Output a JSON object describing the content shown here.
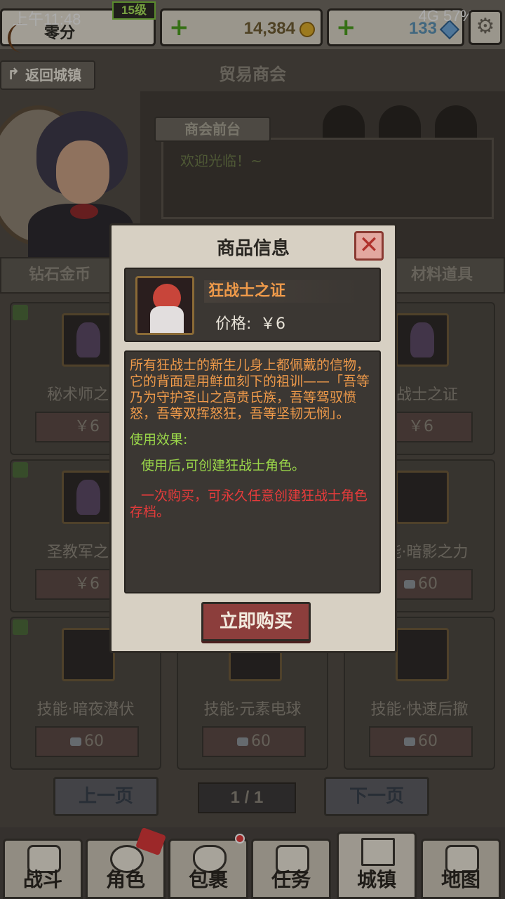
{
  "status_bar": {
    "time": "上午11:48",
    "right": "4G 57%"
  },
  "player": {
    "name": "零分",
    "level": "15级"
  },
  "resources": {
    "coins": "14,384",
    "gems": "133"
  },
  "header": {
    "back_label": "返回城镇",
    "title": "贸易商会"
  },
  "desk": {
    "label": "商会前台",
    "message": "欢迎光临！~"
  },
  "tabs": [
    {
      "label": "钻石金币"
    },
    {
      "label": "材料道具"
    }
  ],
  "grid": {
    "items": [
      {
        "title": "秘术师之证",
        "price": "￥6",
        "currency": "cash"
      },
      {
        "title": "狂战士之证",
        "price": "￥6",
        "currency": "cash"
      },
      {
        "title": "圣教军之证",
        "price": "￥6",
        "currency": "cash"
      },
      {
        "title": "技能·暗影之力",
        "price": "60",
        "currency": "diamond"
      },
      {
        "title": "技能·暗夜潜伏",
        "price": "60",
        "currency": "diamond"
      },
      {
        "title": "技能·元素电球",
        "price": "60",
        "currency": "diamond"
      },
      {
        "title": "技能·快速后撤",
        "price": "60",
        "currency": "diamond"
      }
    ]
  },
  "pager": {
    "prev": "上一页",
    "page": "1 / 1",
    "next": "下一页"
  },
  "nav": [
    {
      "label": "战斗",
      "icon": "crossed-swords-icon"
    },
    {
      "label": "角色",
      "icon": "character-face-icon"
    },
    {
      "label": "包裹",
      "icon": "bag-icon"
    },
    {
      "label": "任务",
      "icon": "quest-scroll-icon"
    },
    {
      "label": "城镇",
      "icon": "castle-icon"
    },
    {
      "label": "地图",
      "icon": "map-icon"
    }
  ],
  "modal": {
    "title": "商品信息",
    "product_name": "狂战士之证",
    "price_label": "价格:",
    "price_value": "￥6",
    "description": "所有狂战士的新生儿身上都佩戴的信物，它的背面是用鲜血刻下的祖训——「吾等乃为守护圣山之高贵氏族，吾等驾驭愤怒，吾等双挥怒狂，吾等坚韧无悯」。",
    "effect_heading": "使用效果:",
    "effect_text": "使用后,可创建狂战士角色。",
    "note": "一次购买，可永久任意创建狂战士角色存档。",
    "buy_label": "立即购买"
  },
  "colors": {
    "accent_orange": "#ef9a4a",
    "effect_green": "#9bd84a",
    "warning_red": "#e53b3b",
    "buy_button": "#8c3e3c"
  }
}
